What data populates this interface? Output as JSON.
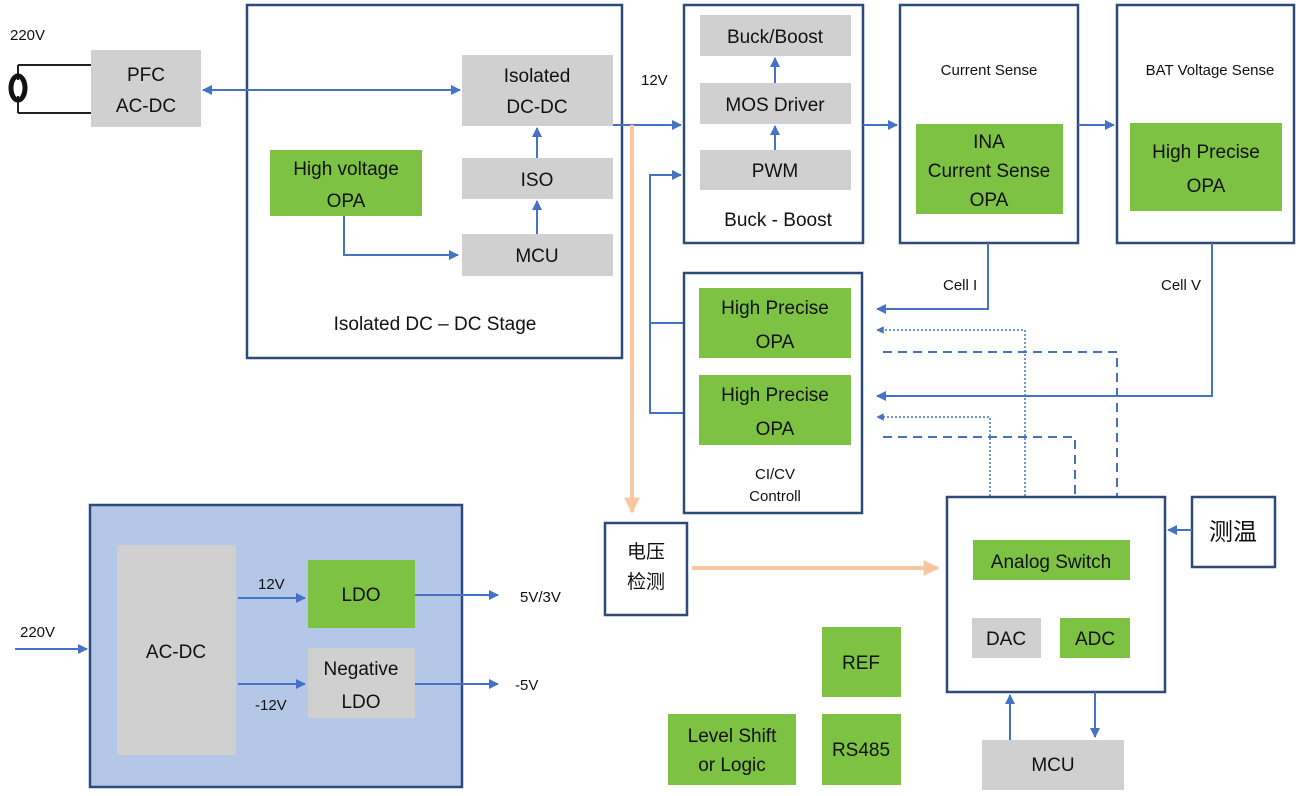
{
  "colors": {
    "line": "#4472c4",
    "frame": "#2f4a7a",
    "block_gray": "#d0d0d0",
    "block_green": "#7dc242",
    "panel_blue": "#b4c7e7",
    "voltage_path": "#f8c7a0"
  },
  "input": {
    "voltage": "220V"
  },
  "pfc": {
    "line1": "PFC",
    "line2": "AC-DC"
  },
  "isolated_stage": {
    "title": "Isolated DC – DC Stage",
    "dcdc1": "Isolated",
    "dcdc2": "DC-DC",
    "iso": "ISO",
    "mcu": "MCU",
    "hv_opa1": "High voltage",
    "hv_opa2": "OPA"
  },
  "rail_12v": "12V",
  "buck_boost": {
    "title": "Buck - Boost",
    "buck": "Buck/Boost",
    "driver": "MOS Driver",
    "pwm": "PWM"
  },
  "current_sense": {
    "title": "Current Sense",
    "l1": "INA",
    "l2": "Current Sense",
    "l3": "OPA"
  },
  "bat_sense": {
    "title": "BAT Voltage Sense",
    "l1": "High Precise",
    "l2": "OPA"
  },
  "signals": {
    "cell_i": "Cell I",
    "cell_v": "Cell V"
  },
  "cicv": {
    "title1": "CI/CV",
    "title2": "Controll",
    "opa1_l1": "High Precise",
    "opa1_l2": "OPA",
    "opa2_l1": "High Precise",
    "opa2_l2": "OPA"
  },
  "voltage_detect": {
    "l1": "电压",
    "l2": "检测"
  },
  "temp": "测温",
  "analog": {
    "switch": "Analog Switch",
    "dac": "DAC",
    "adc": "ADC"
  },
  "mcu_bottom": "MCU",
  "misc": {
    "ref": "REF",
    "rs485": "RS485",
    "level1": "Level Shift",
    "level2": "or Logic"
  },
  "aux_power": {
    "input": "220V",
    "acdc": "AC-DC",
    "v12": "12V",
    "vneg12": "-12V",
    "ldo": "LDO",
    "neg_ldo1": "Negative",
    "neg_ldo2": "LDO",
    "out1": "5V/3V",
    "out2": "-5V"
  }
}
